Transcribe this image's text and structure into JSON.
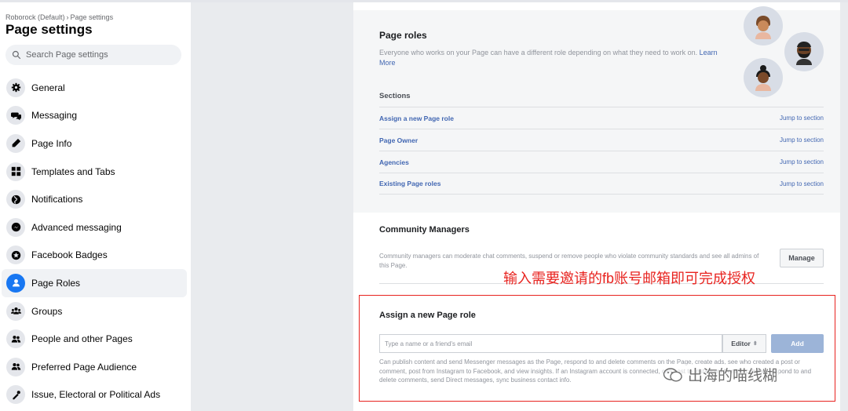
{
  "sidebar": {
    "breadcrumb": [
      "Roborock (Default)",
      "Page settings"
    ],
    "breadcrumb_sep": "›",
    "title": "Page settings",
    "search_placeholder": "Search Page settings",
    "items": [
      {
        "label": "General",
        "icon": "gear-icon"
      },
      {
        "label": "Messaging",
        "icon": "chat-bubbles-icon"
      },
      {
        "label": "Page Info",
        "icon": "pencil-icon"
      },
      {
        "label": "Templates and Tabs",
        "icon": "grid-icon"
      },
      {
        "label": "Notifications",
        "icon": "globe-icon"
      },
      {
        "label": "Advanced messaging",
        "icon": "messenger-icon"
      },
      {
        "label": "Facebook Badges",
        "icon": "badge-icon"
      },
      {
        "label": "Page Roles",
        "icon": "person-icon",
        "active": true
      },
      {
        "label": "Groups",
        "icon": "groups-icon"
      },
      {
        "label": "People and other Pages",
        "icon": "people-icon"
      },
      {
        "label": "Preferred Page Audience",
        "icon": "people-icon"
      },
      {
        "label": "Issue, Electoral or Political Ads",
        "icon": "megaphone-icon"
      }
    ]
  },
  "roles": {
    "title": "Page roles",
    "description": "Everyone who works on your Page can have a different role depending on what they need to work on.",
    "learn_more": "Learn More",
    "sections_label": "Sections",
    "sections": [
      {
        "label": "Assign a new Page role",
        "jump": "Jump to section"
      },
      {
        "label": "Page Owner",
        "jump": "Jump to section"
      },
      {
        "label": "Agencies",
        "jump": "Jump to section"
      },
      {
        "label": "Existing Page roles",
        "jump": "Jump to section"
      }
    ]
  },
  "community": {
    "title": "Community Managers",
    "description": "Community managers can moderate chat comments, suspend or remove people who violate community standards and see all admins of this Page.",
    "manage_label": "Manage"
  },
  "annotation": "输入需要邀请的fb账号邮箱即可完成授权",
  "assign": {
    "title": "Assign a new Page role",
    "input_placeholder": "Type a name or a friend's email",
    "role_value": "Editor",
    "role_chevron": "⬍",
    "add_label": "Add",
    "description": "Can publish content and send Messenger messages as the Page, respond to and delete comments on the Page, create ads, see who created a post or comment, post from Instagram to Facebook, and view insights. If an Instagram account is connected, can post to Instagram from Facebook, respond to and delete comments, send Direct messages, sync business contact info."
  },
  "watermark": "出海的喵线糊",
  "colors": {
    "accent": "#1877f2",
    "link": "#4267b2",
    "annotation_red": "#e8231f"
  }
}
